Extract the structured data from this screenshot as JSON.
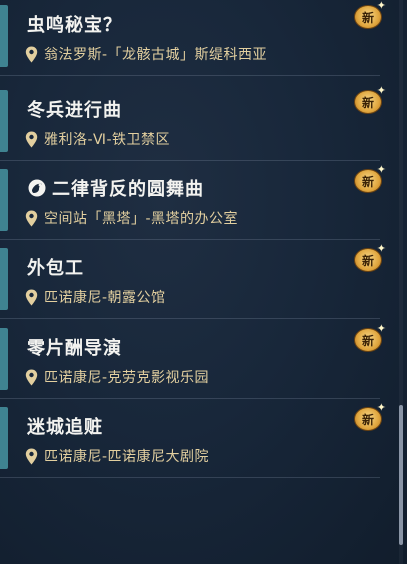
{
  "quests": [
    {
      "title": "虫鸣秘宝？",
      "location": "翁法罗斯-「龙骸古城」斯缇科西亚",
      "badge": "新",
      "has_title_icon": false
    },
    {
      "title": "冬兵进行曲",
      "location": "雅利洛-Ⅵ-铁卫禁区",
      "badge": "新",
      "has_title_icon": false
    },
    {
      "title": "二律背反的圆舞曲",
      "location": "空间站「黑塔」-黑塔的办公室",
      "badge": "新",
      "has_title_icon": true,
      "title_icon": "mission-type-icon"
    },
    {
      "title": "外包工",
      "location": "匹诺康尼-朝露公馆",
      "badge": "新",
      "has_title_icon": false
    },
    {
      "title": "零片酬导演",
      "location": "匹诺康尼-克劳克影视乐园",
      "badge": "新",
      "has_title_icon": false
    },
    {
      "title": "迷城追赃",
      "location": "匹诺康尼-匹诺康尼大剧院",
      "badge": "新",
      "has_title_icon": false
    }
  ],
  "colors": {
    "accent": "#3f8391",
    "location_text": "#e2cf9f",
    "badge_gold": "#e0a63e"
  }
}
